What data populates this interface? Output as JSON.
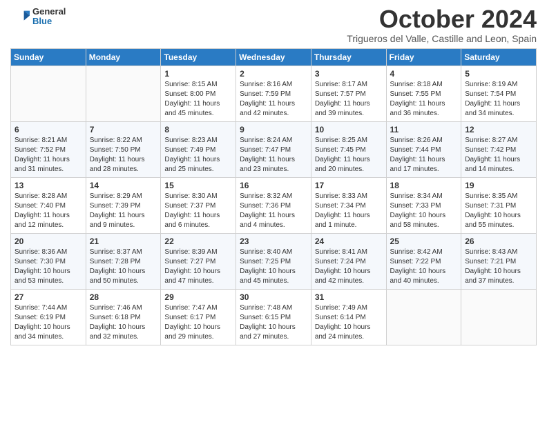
{
  "header": {
    "logo": {
      "general": "General",
      "blue": "Blue"
    },
    "title": "October 2024",
    "location": "Trigueros del Valle, Castille and Leon, Spain"
  },
  "calendar": {
    "days_of_week": [
      "Sunday",
      "Monday",
      "Tuesday",
      "Wednesday",
      "Thursday",
      "Friday",
      "Saturday"
    ],
    "weeks": [
      [
        {
          "day": "",
          "info": ""
        },
        {
          "day": "",
          "info": ""
        },
        {
          "day": "1",
          "info": "Sunrise: 8:15 AM\nSunset: 8:00 PM\nDaylight: 11 hours and 45 minutes."
        },
        {
          "day": "2",
          "info": "Sunrise: 8:16 AM\nSunset: 7:59 PM\nDaylight: 11 hours and 42 minutes."
        },
        {
          "day": "3",
          "info": "Sunrise: 8:17 AM\nSunset: 7:57 PM\nDaylight: 11 hours and 39 minutes."
        },
        {
          "day": "4",
          "info": "Sunrise: 8:18 AM\nSunset: 7:55 PM\nDaylight: 11 hours and 36 minutes."
        },
        {
          "day": "5",
          "info": "Sunrise: 8:19 AM\nSunset: 7:54 PM\nDaylight: 11 hours and 34 minutes."
        }
      ],
      [
        {
          "day": "6",
          "info": "Sunrise: 8:21 AM\nSunset: 7:52 PM\nDaylight: 11 hours and 31 minutes."
        },
        {
          "day": "7",
          "info": "Sunrise: 8:22 AM\nSunset: 7:50 PM\nDaylight: 11 hours and 28 minutes."
        },
        {
          "day": "8",
          "info": "Sunrise: 8:23 AM\nSunset: 7:49 PM\nDaylight: 11 hours and 25 minutes."
        },
        {
          "day": "9",
          "info": "Sunrise: 8:24 AM\nSunset: 7:47 PM\nDaylight: 11 hours and 23 minutes."
        },
        {
          "day": "10",
          "info": "Sunrise: 8:25 AM\nSunset: 7:45 PM\nDaylight: 11 hours and 20 minutes."
        },
        {
          "day": "11",
          "info": "Sunrise: 8:26 AM\nSunset: 7:44 PM\nDaylight: 11 hours and 17 minutes."
        },
        {
          "day": "12",
          "info": "Sunrise: 8:27 AM\nSunset: 7:42 PM\nDaylight: 11 hours and 14 minutes."
        }
      ],
      [
        {
          "day": "13",
          "info": "Sunrise: 8:28 AM\nSunset: 7:40 PM\nDaylight: 11 hours and 12 minutes."
        },
        {
          "day": "14",
          "info": "Sunrise: 8:29 AM\nSunset: 7:39 PM\nDaylight: 11 hours and 9 minutes."
        },
        {
          "day": "15",
          "info": "Sunrise: 8:30 AM\nSunset: 7:37 PM\nDaylight: 11 hours and 6 minutes."
        },
        {
          "day": "16",
          "info": "Sunrise: 8:32 AM\nSunset: 7:36 PM\nDaylight: 11 hours and 4 minutes."
        },
        {
          "day": "17",
          "info": "Sunrise: 8:33 AM\nSunset: 7:34 PM\nDaylight: 11 hours and 1 minute."
        },
        {
          "day": "18",
          "info": "Sunrise: 8:34 AM\nSunset: 7:33 PM\nDaylight: 10 hours and 58 minutes."
        },
        {
          "day": "19",
          "info": "Sunrise: 8:35 AM\nSunset: 7:31 PM\nDaylight: 10 hours and 55 minutes."
        }
      ],
      [
        {
          "day": "20",
          "info": "Sunrise: 8:36 AM\nSunset: 7:30 PM\nDaylight: 10 hours and 53 minutes."
        },
        {
          "day": "21",
          "info": "Sunrise: 8:37 AM\nSunset: 7:28 PM\nDaylight: 10 hours and 50 minutes."
        },
        {
          "day": "22",
          "info": "Sunrise: 8:39 AM\nSunset: 7:27 PM\nDaylight: 10 hours and 47 minutes."
        },
        {
          "day": "23",
          "info": "Sunrise: 8:40 AM\nSunset: 7:25 PM\nDaylight: 10 hours and 45 minutes."
        },
        {
          "day": "24",
          "info": "Sunrise: 8:41 AM\nSunset: 7:24 PM\nDaylight: 10 hours and 42 minutes."
        },
        {
          "day": "25",
          "info": "Sunrise: 8:42 AM\nSunset: 7:22 PM\nDaylight: 10 hours and 40 minutes."
        },
        {
          "day": "26",
          "info": "Sunrise: 8:43 AM\nSunset: 7:21 PM\nDaylight: 10 hours and 37 minutes."
        }
      ],
      [
        {
          "day": "27",
          "info": "Sunrise: 7:44 AM\nSunset: 6:19 PM\nDaylight: 10 hours and 34 minutes."
        },
        {
          "day": "28",
          "info": "Sunrise: 7:46 AM\nSunset: 6:18 PM\nDaylight: 10 hours and 32 minutes."
        },
        {
          "day": "29",
          "info": "Sunrise: 7:47 AM\nSunset: 6:17 PM\nDaylight: 10 hours and 29 minutes."
        },
        {
          "day": "30",
          "info": "Sunrise: 7:48 AM\nSunset: 6:15 PM\nDaylight: 10 hours and 27 minutes."
        },
        {
          "day": "31",
          "info": "Sunrise: 7:49 AM\nSunset: 6:14 PM\nDaylight: 10 hours and 24 minutes."
        },
        {
          "day": "",
          "info": ""
        },
        {
          "day": "",
          "info": ""
        }
      ]
    ]
  }
}
